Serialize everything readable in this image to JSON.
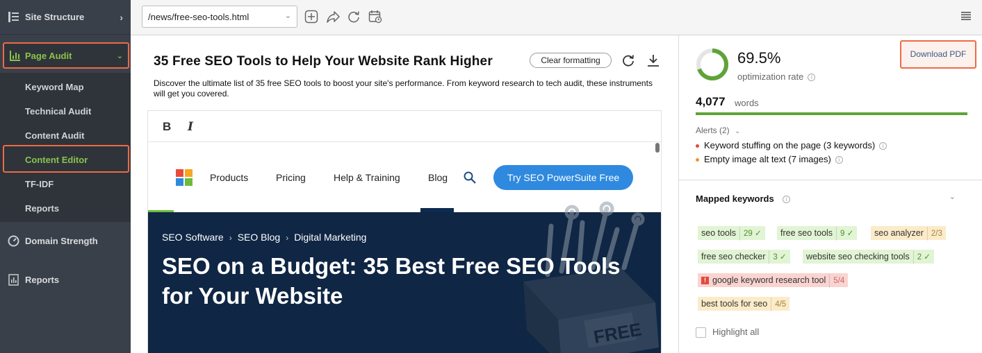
{
  "sidebar": {
    "site_structure": "Site Structure",
    "page_audit": "Page Audit",
    "items": [
      {
        "label": "Keyword Map"
      },
      {
        "label": "Technical Audit"
      },
      {
        "label": "Content Audit"
      },
      {
        "label": "Content Editor"
      },
      {
        "label": "TF-IDF"
      },
      {
        "label": "Reports"
      }
    ],
    "domain_strength": "Domain Strength",
    "reports": "Reports"
  },
  "toolbar": {
    "url": "/news/free-seo-tools.html"
  },
  "editor": {
    "title": "35 Free SEO Tools to Help Your Website Rank Higher",
    "clear_formatting": "Clear formatting",
    "description": "Discover the ultimate list of 35 free SEO tools to boost your site's performance. From keyword research to tech audit, these instruments will get you covered.",
    "bold": "B",
    "italic": "I"
  },
  "webpage": {
    "nav": [
      "Products",
      "Pricing",
      "Help & Training",
      "Blog"
    ],
    "cta": "Try SEO PowerSuite Free",
    "breadcrumbs": [
      "SEO Software",
      "SEO Blog",
      "Digital Marketing"
    ],
    "hero_title": "SEO on a Budget: 35 Best Free SEO Tools for Your Website",
    "box_label": "FREE"
  },
  "panel": {
    "rate": "69.5%",
    "rate_value": 0.695,
    "rate_label": "optimization rate",
    "download_pdf": "Download PDF",
    "words": "4,077",
    "words_label": "words",
    "alerts_header": "Alerts (2)",
    "alerts": [
      {
        "text": "Keyword stuffing on the page (3 keywords)",
        "color": "#e04b3d"
      },
      {
        "text": "Empty image alt text (7 images)",
        "color": "#f0952c"
      }
    ],
    "mapped_keywords_header": "Mapped keywords",
    "keywords": [
      {
        "text": "seo tools",
        "count": "29",
        "status": "green"
      },
      {
        "text": "free seo tools",
        "count": "9",
        "status": "green"
      },
      {
        "text": "seo analyzer",
        "count": "2/3",
        "status": "yellow"
      },
      {
        "text": "free seo checker",
        "count": "3",
        "status": "green"
      },
      {
        "text": "website seo checking tools",
        "count": "2",
        "status": "green"
      },
      {
        "text": "google keyword research tool",
        "count": "5/4",
        "status": "red"
      },
      {
        "text": "best tools for seo",
        "count": "4/5",
        "status": "yellow"
      }
    ],
    "highlight_all": "Highlight all"
  },
  "colors": {
    "sidebar_bg": "#3a4049",
    "accent_green": "#8bc34a",
    "highlight_orange": "#ee6a45",
    "cta_blue": "#2f8adf",
    "hero_navy": "#0f2644"
  }
}
